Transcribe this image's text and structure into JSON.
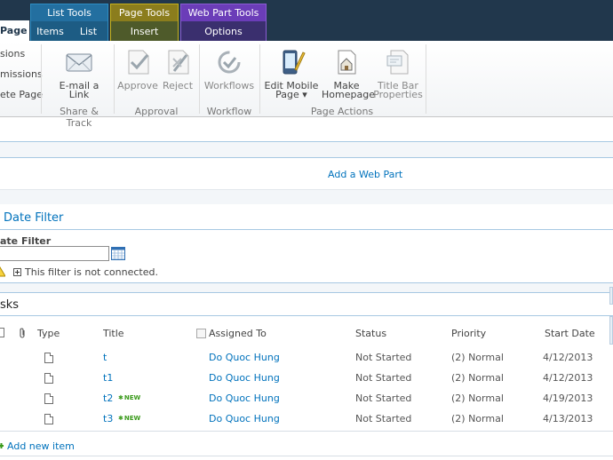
{
  "tabs": {
    "page_active": "Page",
    "list_tools": {
      "label": "List Tools",
      "tabs": [
        "Items",
        "List"
      ]
    },
    "page_tools": {
      "label": "Page Tools",
      "tabs": [
        "Insert"
      ]
    },
    "web_part_tools": {
      "label": "Web Part Tools",
      "tabs": [
        "Options"
      ]
    }
  },
  "ribbon": {
    "left_items": [
      "sions",
      "missions",
      "ete Page"
    ],
    "share_track": {
      "group_label": "Share & Track",
      "email_link": "E-mail a\nLink"
    },
    "approval": {
      "group_label": "Approval",
      "approve": "Approve",
      "reject": "Reject"
    },
    "workflow": {
      "group_label": "Workflow",
      "workflows": "Workflows"
    },
    "page_actions": {
      "group_label": "Page Actions",
      "edit_mobile": "Edit Mobile\nPage ▾",
      "make_homepage": "Make\nHomepage",
      "title_bar_props": "Title Bar\nProperties"
    }
  },
  "content": {
    "add_web_part": "Add a Web Part",
    "date_filter_title": "Date Filter",
    "date_filter_label": "ate Filter",
    "filter_warning": "This filter is not connected.",
    "tasks_title": "sks",
    "columns": [
      "Type",
      "Title",
      "Assigned To",
      "Status",
      "Priority",
      "Start Date"
    ],
    "rows": [
      {
        "title": "t",
        "assigned": "Do Quoc Hung",
        "status": "Not Started",
        "priority": "(2) Normal",
        "start": "4/12/2013",
        "new": false
      },
      {
        "title": "t1",
        "assigned": "Do Quoc Hung",
        "status": "Not Started",
        "priority": "(2) Normal",
        "start": "4/12/2013",
        "new": false
      },
      {
        "title": "t2",
        "assigned": "Do Quoc Hung",
        "status": "Not Started",
        "priority": "(2) Normal",
        "start": "4/19/2013",
        "new": true
      },
      {
        "title": "t3",
        "assigned": "Do Quoc Hung",
        "status": "Not Started",
        "priority": "(2) Normal",
        "start": "4/13/2013",
        "new": true
      }
    ],
    "new_badge": "NEW",
    "add_new_item": "Add new item"
  }
}
